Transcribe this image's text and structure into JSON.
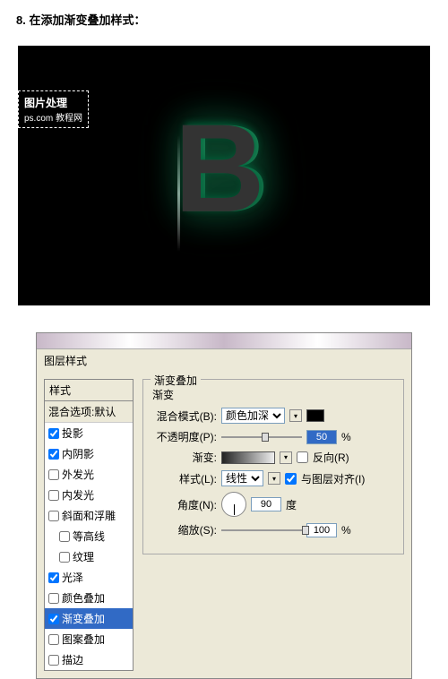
{
  "step": "8. 在添加渐变叠加样式：",
  "watermark": {
    "line1": "图片处理",
    "line2": "ps.com 教程网"
  },
  "preview_letter": "B",
  "dialog": {
    "title": "图层样式",
    "styles_header": "样式",
    "blend_default": "混合选项:默认",
    "items": [
      {
        "label": "投影",
        "checked": true
      },
      {
        "label": "内阴影",
        "checked": true
      },
      {
        "label": "外发光",
        "checked": false
      },
      {
        "label": "内发光",
        "checked": false
      },
      {
        "label": "斜面和浮雕",
        "checked": false
      },
      {
        "label": "等高线",
        "checked": false,
        "sub": true
      },
      {
        "label": "纹理",
        "checked": false,
        "sub": true
      },
      {
        "label": "光泽",
        "checked": true
      },
      {
        "label": "颜色叠加",
        "checked": false
      },
      {
        "label": "渐变叠加",
        "checked": true,
        "selected": true
      },
      {
        "label": "图案叠加",
        "checked": false
      },
      {
        "label": "描边",
        "checked": false
      }
    ],
    "section": "渐变叠加",
    "subsection": "渐变",
    "blend_mode_label": "混合模式(B):",
    "blend_mode_value": "颜色加深",
    "opacity_label": "不透明度(P):",
    "opacity_value": "50",
    "percent": "%",
    "gradient_label": "渐变:",
    "reverse_label": "反向(R)",
    "style_label": "样式(L):",
    "style_value": "线性",
    "align_label": "与图层对齐(I)",
    "angle_label": "角度(N):",
    "angle_value": "90",
    "degree": "度",
    "scale_label": "缩放(S):",
    "scale_value": "100"
  }
}
